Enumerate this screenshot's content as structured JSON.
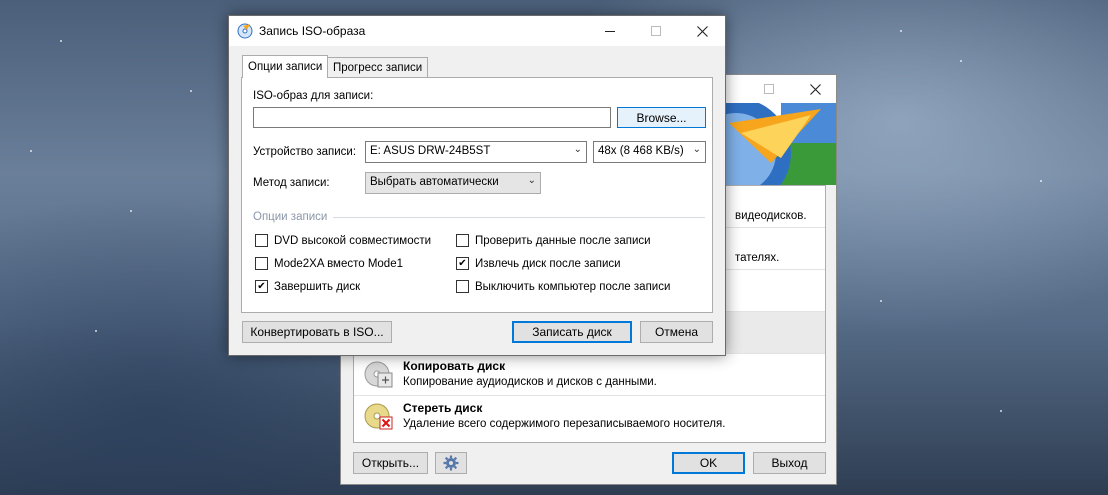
{
  "main_window": {
    "tasks": [
      {
        "title": "",
        "desc": "видеодисков."
      },
      {
        "title": "",
        "desc": "тателях."
      },
      {
        "title": "",
        "desc": ""
      },
      {
        "title": "Копировать диск",
        "desc": "Копирование аудиодисков и дисков с данными."
      },
      {
        "title": "Стереть диск",
        "desc": "Удаление всего содержимого перезаписываемого носителя."
      }
    ],
    "buttons": {
      "open": "Открыть...",
      "ok": "OK",
      "exit": "Выход"
    }
  },
  "dialog": {
    "title": "Запись ISO-образа",
    "tabs": [
      {
        "label": "Опции записи",
        "active": true
      },
      {
        "label": "Прогресс записи",
        "active": false
      }
    ],
    "iso_label": "ISO-образ для записи:",
    "iso_value": "",
    "browse": "Browse...",
    "device_label": "Устройство записи:",
    "device_value": "E: ASUS DRW-24B5ST",
    "speed_value": "48x (8 468 KB/s)",
    "method_label": "Метод записи:",
    "method_value": "Выбрать автоматически",
    "options_group": "Опции записи",
    "options": [
      {
        "label": "DVD высокой совместимости",
        "checked": false
      },
      {
        "label": "Проверить данные после записи",
        "checked": false
      },
      {
        "label": "Mode2XA вместо Mode1",
        "checked": false
      },
      {
        "label": "Извлечь диск после записи",
        "checked": true
      },
      {
        "label": "Завершить диск",
        "checked": true
      },
      {
        "label": "Выключить компьютер после записи",
        "checked": false
      }
    ],
    "buttons": {
      "convert": "Конвертировать в ISO...",
      "burn": "Записать диск",
      "cancel": "Отмена"
    }
  },
  "icons": {
    "minimize": "minimize-icon",
    "maximize": "maximize-icon",
    "close": "close-icon",
    "check": "✔",
    "chevron": "⌄"
  },
  "colors": {
    "accent": "#0078d7",
    "group_heading": "#8a96a8"
  }
}
